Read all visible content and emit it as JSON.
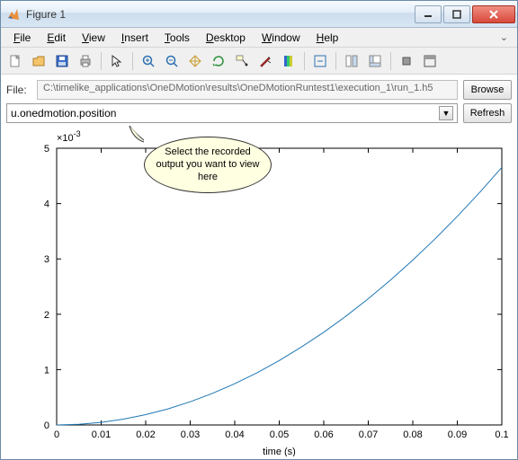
{
  "window": {
    "title": "Figure 1"
  },
  "menu": {
    "file": "File",
    "edit": "Edit",
    "view": "View",
    "insert": "Insert",
    "tools": "Tools",
    "desktop": "Desktop",
    "window": "Window",
    "help": "Help"
  },
  "toolbar_icons": [
    "new-file-icon",
    "open-icon",
    "save-icon",
    "print-icon",
    "pointer-icon",
    "zoom-in-icon",
    "zoom-out-icon",
    "pan-icon",
    "rotate-icon",
    "data-cursor-icon",
    "brush-icon",
    "colorbar-icon",
    "link-icon",
    "hide-plot-tools-icon",
    "show-plot-tools-icon",
    "restore-icon",
    "dock-icon"
  ],
  "file_row": {
    "label": "File:",
    "path": "C:\\timelike_applications\\OneDMotion\\results\\OneDMotionRuntest1\\execution_1\\run_1.h5",
    "browse": "Browse"
  },
  "var_row": {
    "selected": "u.onedmotion.position",
    "refresh": "Refresh"
  },
  "callout": {
    "text": "Select the recorded output you want to view here"
  },
  "chart_data": {
    "type": "line",
    "xlabel": "time (s)",
    "ylabel": "",
    "y_multiplier_text": "×10",
    "y_multiplier_exp": "-3",
    "xlim": [
      0,
      0.1
    ],
    "ylim": [
      0,
      5
    ],
    "xticks": [
      0,
      0.01,
      0.02,
      0.03,
      0.04,
      0.05,
      0.06,
      0.07,
      0.08,
      0.09,
      0.1
    ],
    "yticks": [
      0,
      1,
      2,
      3,
      4,
      5
    ],
    "x": [
      0,
      0.005,
      0.01,
      0.015,
      0.02,
      0.025,
      0.03,
      0.035,
      0.04,
      0.045,
      0.05,
      0.055,
      0.06,
      0.065,
      0.07,
      0.075,
      0.08,
      0.085,
      0.09,
      0.095,
      0.1
    ],
    "y_e3": [
      0,
      0.012,
      0.047,
      0.105,
      0.186,
      0.291,
      0.419,
      0.571,
      0.745,
      0.943,
      1.164,
      1.409,
      1.676,
      1.967,
      2.281,
      2.618,
      2.979,
      3.363,
      3.77,
      4.2,
      4.654
    ]
  }
}
